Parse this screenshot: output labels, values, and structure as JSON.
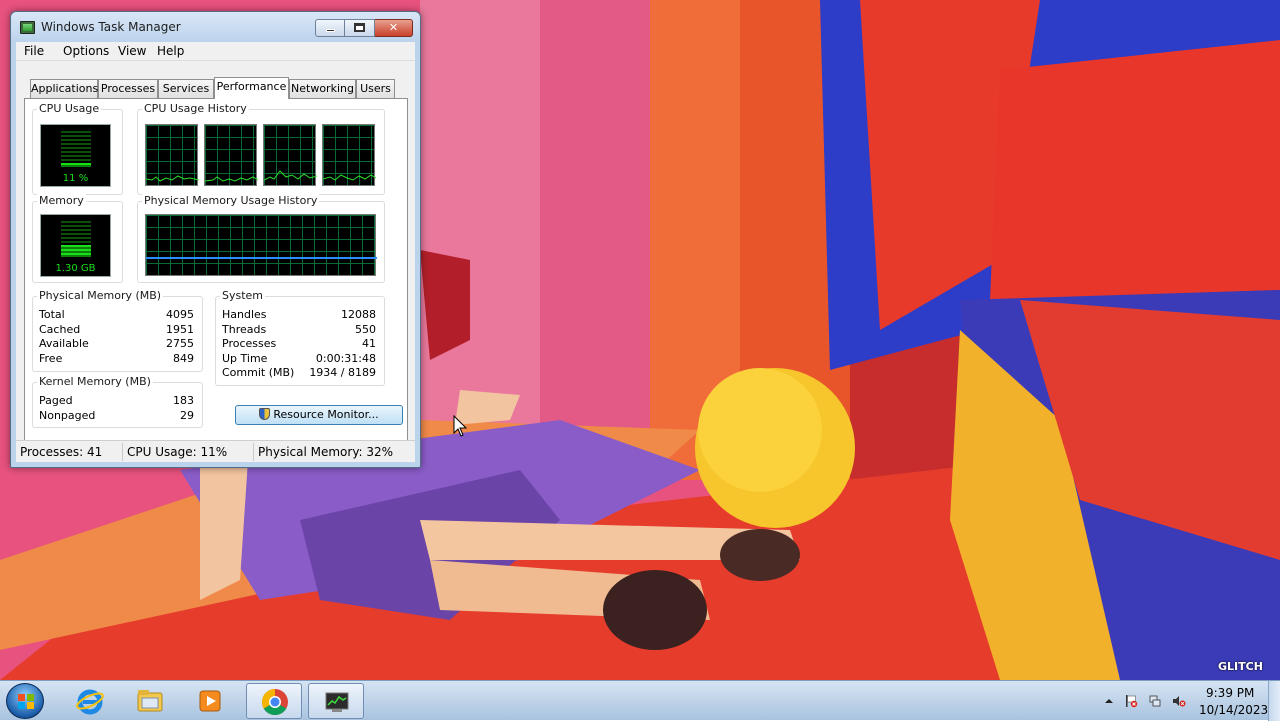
{
  "window": {
    "title": "Windows Task Manager",
    "menu": [
      "File",
      "Options",
      "View",
      "Help"
    ],
    "tabs": [
      "Applications",
      "Processes",
      "Services",
      "Performance",
      "Networking",
      "Users"
    ],
    "active_tab": "Performance"
  },
  "performance": {
    "cpu_usage": {
      "title": "CPU Usage",
      "value": "11 %",
      "level": 0.11
    },
    "cpu_history": {
      "title": "CPU Usage History"
    },
    "memory": {
      "title": "Memory",
      "value": "1.30 GB",
      "level": 0.32
    },
    "memory_history": {
      "title": "Physical Memory Usage History"
    },
    "physical_memory": {
      "title": "Physical Memory (MB)",
      "rows": [
        {
          "label": "Total",
          "value": "4095"
        },
        {
          "label": "Cached",
          "value": "1951"
        },
        {
          "label": "Available",
          "value": "2755"
        },
        {
          "label": "Free",
          "value": "849"
        }
      ]
    },
    "kernel_memory": {
      "title": "Kernel Memory (MB)",
      "rows": [
        {
          "label": "Paged",
          "value": "183"
        },
        {
          "label": "Nonpaged",
          "value": "29"
        }
      ]
    },
    "system": {
      "title": "System",
      "rows": [
        {
          "label": "Handles",
          "value": "12088"
        },
        {
          "label": "Threads",
          "value": "550"
        },
        {
          "label": "Processes",
          "value": "41"
        },
        {
          "label": "Up Time",
          "value": "0:00:31:48"
        },
        {
          "label": "Commit (MB)",
          "value": "1934 / 8189"
        }
      ]
    },
    "resource_monitor_label": "Resource Monitor..."
  },
  "statusbar": {
    "processes": "Processes: 41",
    "cpu": "CPU Usage: 11%",
    "memory": "Physical Memory: 32%"
  },
  "taskbar": {
    "pinned": [
      "internet-explorer-icon",
      "windows-explorer-icon",
      "media-player-icon",
      "chrome-icon",
      "task-manager-icon"
    ],
    "clock_time": "9:39 PM",
    "clock_date": "10/14/2023"
  },
  "colors": {
    "graph_line": "#2ce02c",
    "memory_line": "#2a8cff",
    "meter_green": "#17e017"
  }
}
